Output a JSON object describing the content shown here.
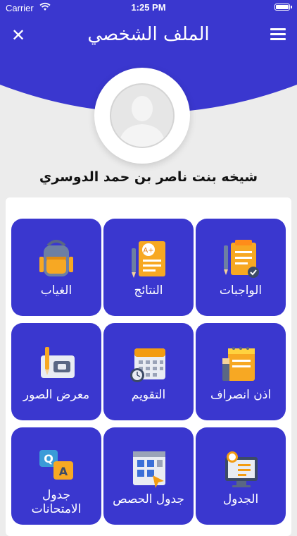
{
  "status_bar": {
    "carrier": "Carrier",
    "time": "1:25 PM"
  },
  "header": {
    "title": "الملف الشخصي",
    "close_icon": "close-icon",
    "menu_icon": "hamburger-menu-icon",
    "background_color": "#3a37cf"
  },
  "profile": {
    "name": "شيخه بنت ناصر بن حمد الدوسري"
  },
  "tiles": [
    {
      "label": "الواجبات",
      "icon": "homework-clipboard-icon"
    },
    {
      "label": "النتائج",
      "icon": "results-grade-icon"
    },
    {
      "label": "الغياب",
      "icon": "absence-backpack-icon"
    },
    {
      "label": "اذن انصراف",
      "icon": "leave-permission-notepad-icon"
    },
    {
      "label": "التقويم",
      "icon": "calendar-icon"
    },
    {
      "label": "معرض الصور",
      "icon": "photo-gallery-icon"
    },
    {
      "label": "الجدول",
      "icon": "schedule-monitor-icon"
    },
    {
      "label": "جدول الحصص",
      "icon": "class-timetable-icon"
    },
    {
      "label": "جدول الامتحانات",
      "icon": "exam-qa-icon"
    }
  ],
  "colors": {
    "tile": "#3a37cf",
    "page_background": "#ececec"
  }
}
